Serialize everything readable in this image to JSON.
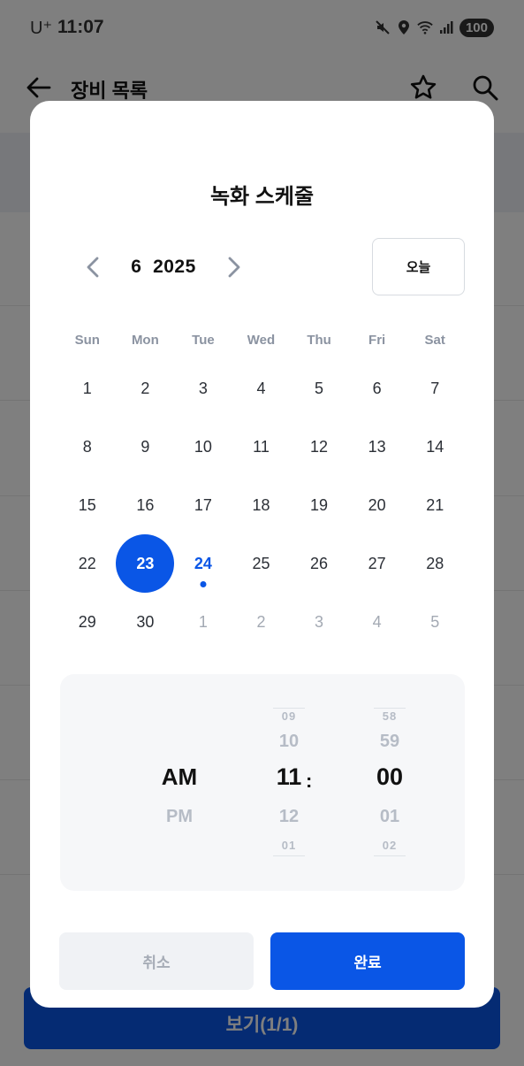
{
  "status_bar": {
    "carrier": "U⁺",
    "time": "11:07",
    "battery": "100",
    "icons": [
      "mute-icon",
      "location-icon",
      "wifi-icon",
      "signal-icon",
      "battery-icon"
    ]
  },
  "app": {
    "title": "장비 목록",
    "back_icon": "back-arrow-icon",
    "favorite_icon": "star-icon",
    "search_icon": "search-icon",
    "footer_button": "보기(1/1)"
  },
  "modal": {
    "title": "녹화 스케줄",
    "month": "6",
    "year": "2025",
    "prev_icon": "chevron-left-icon",
    "next_icon": "chevron-right-icon",
    "today_button": "오늘",
    "weekdays": [
      "Sun",
      "Mon",
      "Tue",
      "Wed",
      "Thu",
      "Fri",
      "Sat"
    ],
    "weeks": [
      [
        "1",
        "2",
        "3",
        "4",
        "5",
        "6",
        "7"
      ],
      [
        "8",
        "9",
        "10",
        "11",
        "12",
        "13",
        "14"
      ],
      [
        "15",
        "16",
        "17",
        "18",
        "19",
        "20",
        "21"
      ],
      [
        "22",
        "23",
        "24",
        "25",
        "26",
        "27",
        "28"
      ],
      [
        "29",
        "30",
        "1",
        "2",
        "3",
        "4",
        "5"
      ]
    ],
    "selected_day": "23",
    "today_day": "24",
    "time_picker": {
      "ampm": {
        "selected": "AM",
        "below": "PM"
      },
      "hour": {
        "far_above": "09",
        "above": "10",
        "selected": "11",
        "below": "12",
        "far_below": "01"
      },
      "separator": ":",
      "minute": {
        "far_above": "58",
        "above": "59",
        "selected": "00",
        "below": "01",
        "far_below": "02"
      }
    },
    "cancel_button": "취소",
    "done_button": "완료"
  },
  "colors": {
    "accent": "#0a56e6",
    "muted_text": "#8b93a1",
    "overlay": "rgba(0,0,0,0.5)"
  }
}
